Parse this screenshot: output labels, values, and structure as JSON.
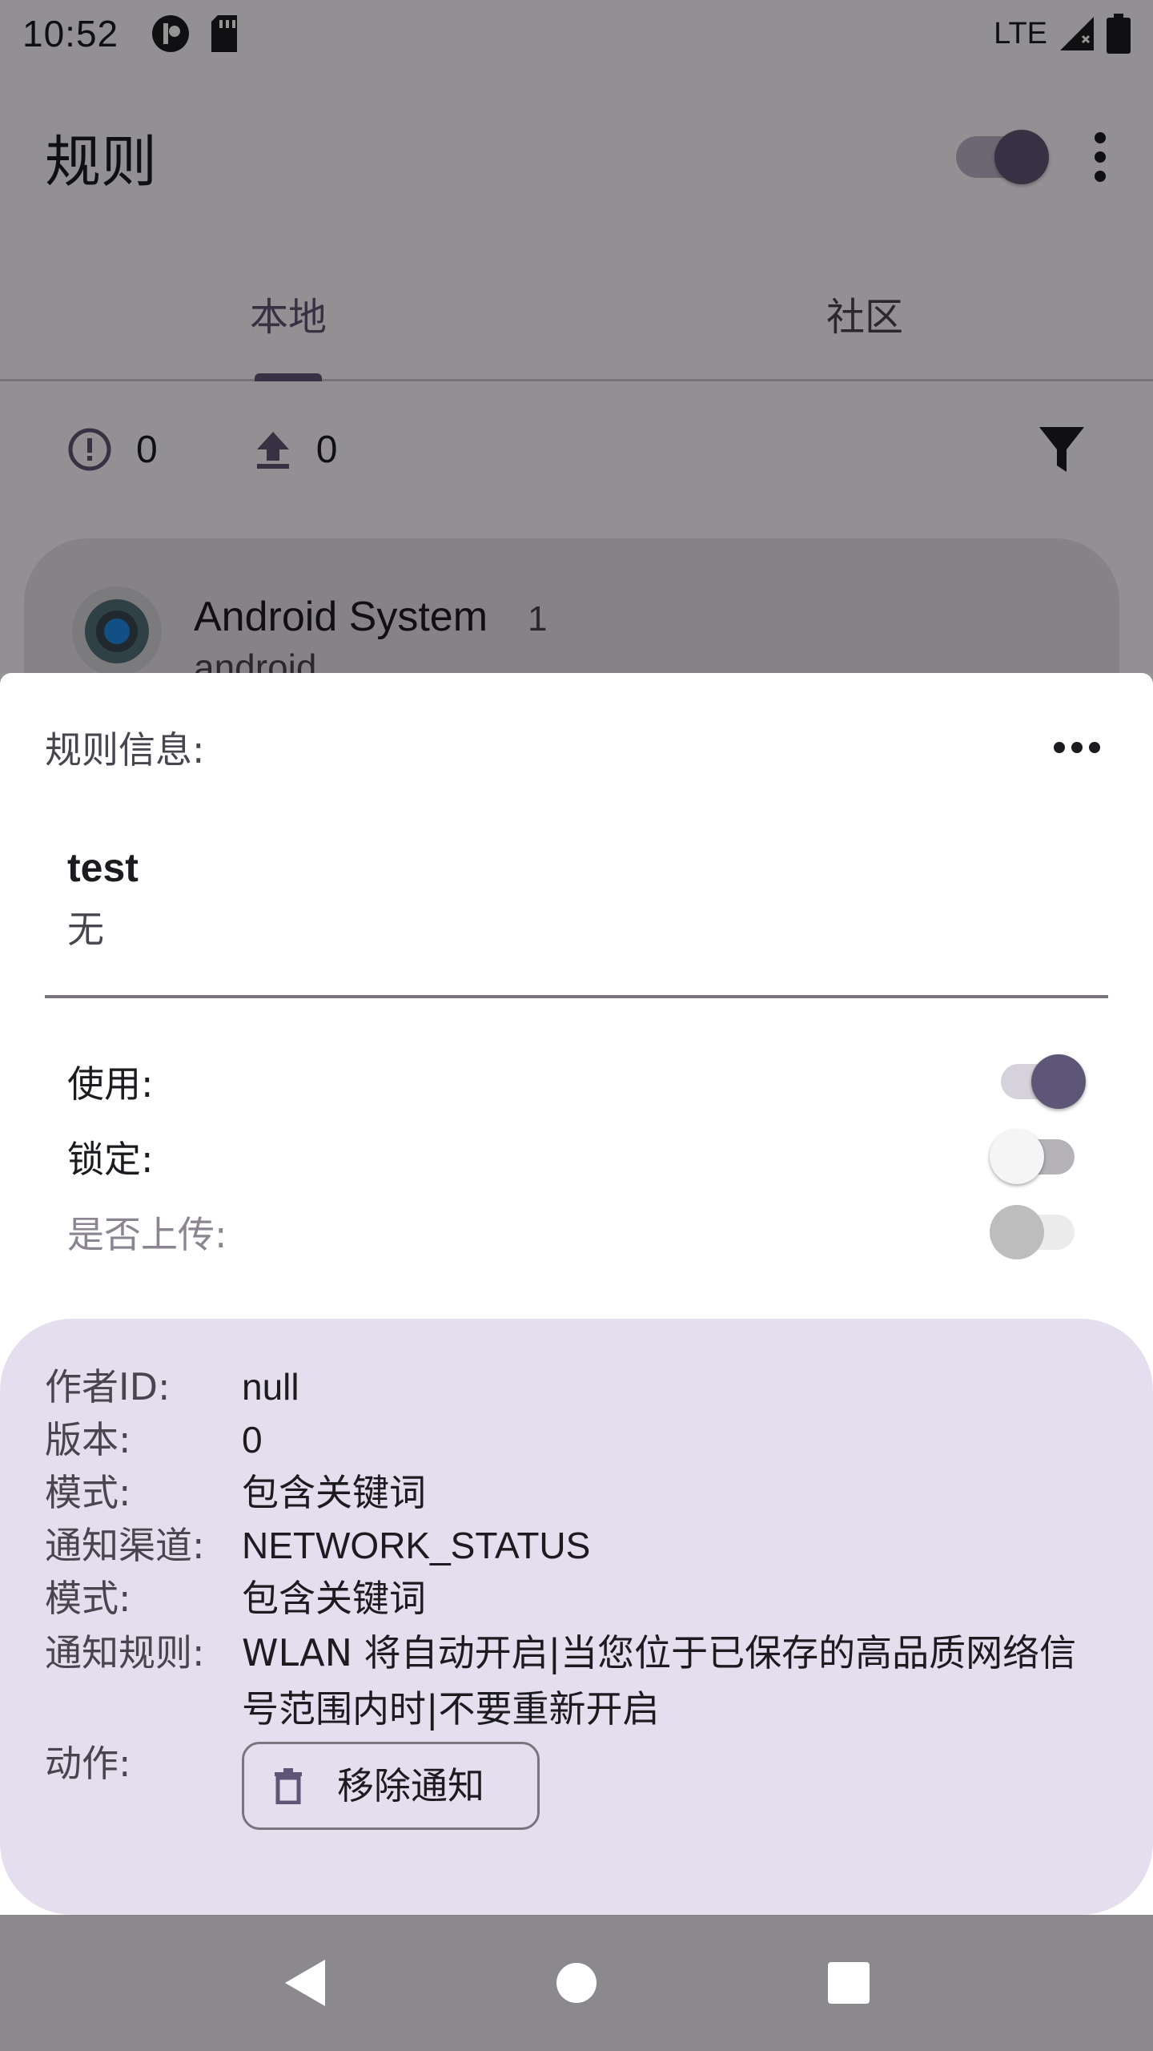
{
  "status_bar": {
    "time": "10:52",
    "network": "LTE"
  },
  "toolbar": {
    "title": "规则",
    "master_switch_on": true
  },
  "tabs": [
    {
      "label": "本地",
      "active": true
    },
    {
      "label": "社区",
      "active": false
    }
  ],
  "counts": {
    "error_count": "0",
    "upload_count": "0"
  },
  "app_card": {
    "name": "Android System",
    "count": "1",
    "package": "android"
  },
  "sheet": {
    "title": "规则信息:",
    "rule_name": "test",
    "rule_desc": "无",
    "options": [
      {
        "label": "使用:",
        "state": "on",
        "enabled": true
      },
      {
        "label": "锁定:",
        "state": "off",
        "enabled": true
      },
      {
        "label": "是否上传:",
        "state": "off",
        "enabled": false
      }
    ],
    "info": {
      "author_key": "作者ID:",
      "author_val": "null",
      "version_key": "版本:",
      "version_val": "0",
      "mode_key": "模式:",
      "mode_val": "包含关键词",
      "channel_key": "通知渠道:",
      "channel_val": "NETWORK_STATUS",
      "mode2_key": "模式:",
      "mode2_val": "包含关键词",
      "rule_key": "通知规则:",
      "rule_val": "WLAN 将自动开启|当您位于已保存的高品质网络信号范围内时|不要重新开启",
      "action_key": "动作:",
      "action_label": "移除通知"
    }
  },
  "colors": {
    "accent": "#5d5676",
    "card_bg": "#e5deee",
    "scrim": "rgba(0,0,0,0.42)"
  }
}
